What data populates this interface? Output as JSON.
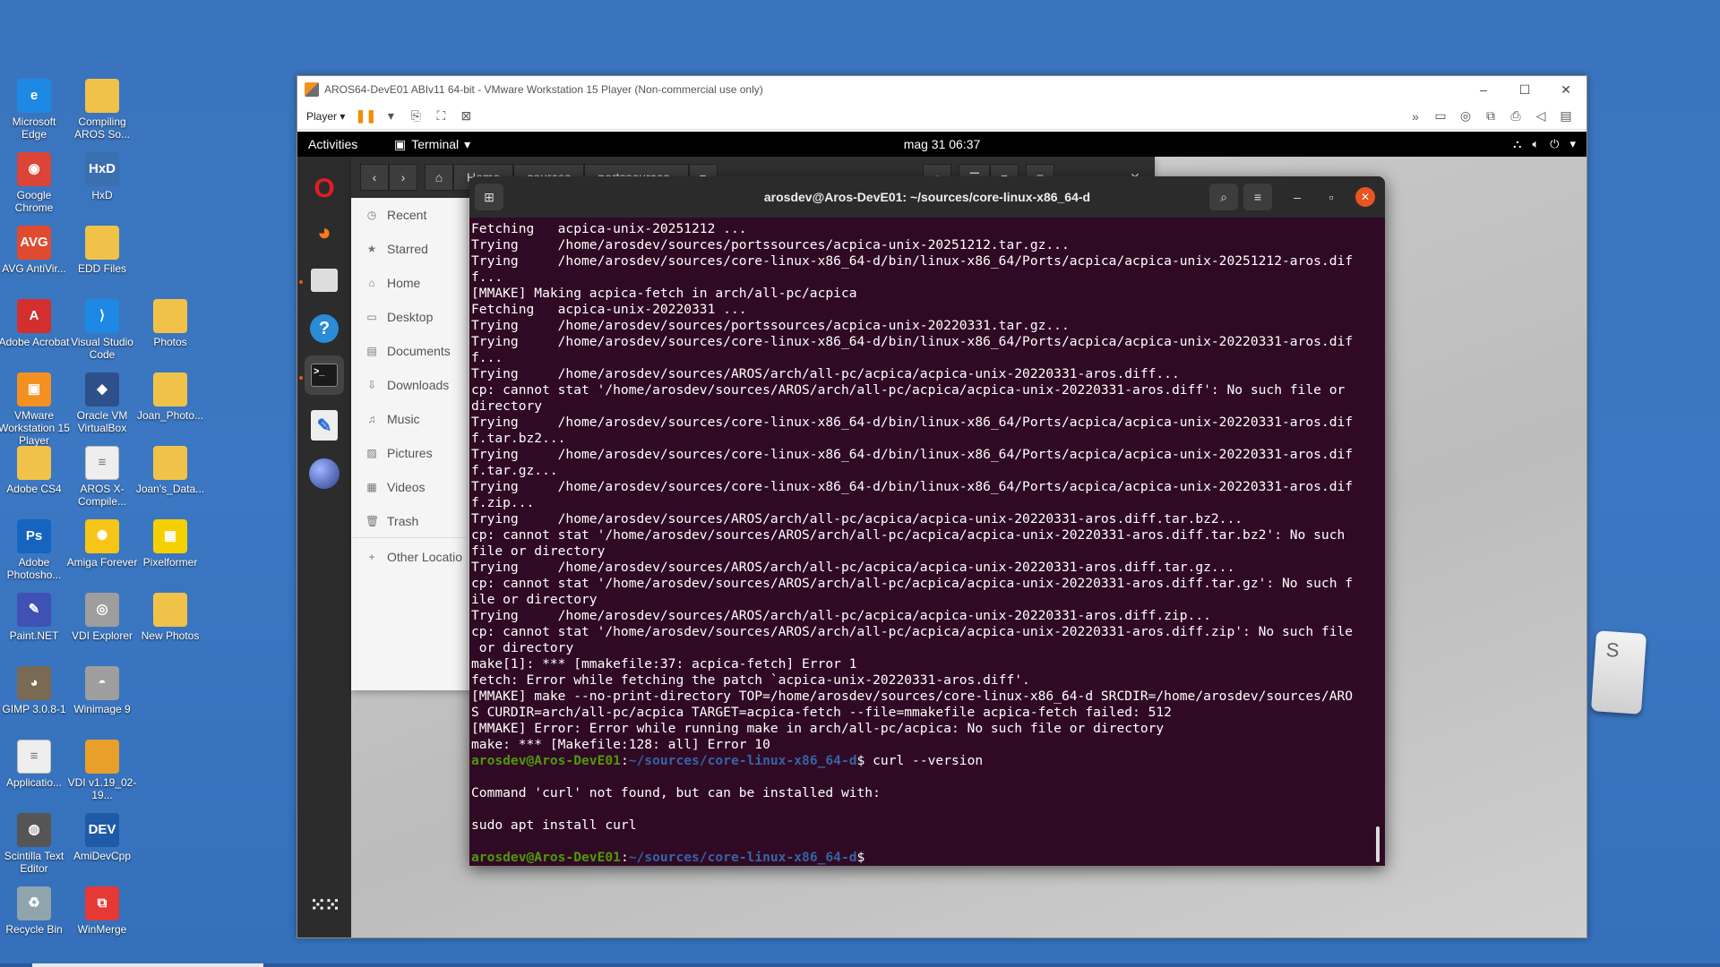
{
  "desktop": {
    "icons": [
      {
        "label": "Microsoft Edge",
        "glyph": "e",
        "color": "#1e88e5"
      },
      {
        "label": "Compiling AROS So...",
        "glyph": "",
        "color": "#f0c24a"
      },
      {
        "label": "Google Chrome",
        "glyph": "◉",
        "color": "#db4437"
      },
      {
        "label": "HxD",
        "glyph": "HxD",
        "color": "#3a6fb0"
      },
      {
        "label": "AVG AntiVir...",
        "glyph": "AVG",
        "color": "#e04a2f"
      },
      {
        "label": "EDD Files",
        "glyph": "",
        "color": "#f0c24a"
      },
      {
        "label": "Adobe Acrobat",
        "glyph": "A",
        "color": "#d32f2f"
      },
      {
        "label": "Visual Studio Code",
        "glyph": "⟩",
        "color": "#1e88e5"
      },
      {
        "label": "Photos",
        "glyph": "",
        "color": "#f0c24a"
      },
      {
        "label": "VMware Workstation 15 Player",
        "glyph": "▣",
        "color": "#f29121"
      },
      {
        "label": "Oracle VM VirtualBox",
        "glyph": "◆",
        "color": "#2d4f8a"
      },
      {
        "label": "Joan_Photo...",
        "glyph": "",
        "color": "#f0c24a"
      },
      {
        "label": "Adobe CS4",
        "glyph": "",
        "color": "#f0c24a"
      },
      {
        "label": "AROS X-Compile...",
        "glyph": "≡",
        "color": "#eeeeee"
      },
      {
        "label": "Joan's_Data...",
        "glyph": "",
        "color": "#f0c24a"
      },
      {
        "label": "Adobe Photosho...",
        "glyph": "Ps",
        "color": "#1565c0"
      },
      {
        "label": "Amiga Forever",
        "glyph": "✺",
        "color": "#f5c518"
      },
      {
        "label": "Pixelformer",
        "glyph": "▦",
        "color": "#f5d000"
      },
      {
        "label": "Paint.NET",
        "glyph": "✎",
        "color": "#3f51b5"
      },
      {
        "label": "VDI Explorer",
        "glyph": "◎",
        "color": "#9e9e9e"
      },
      {
        "label": "New Photos",
        "glyph": "",
        "color": "#f0c24a"
      },
      {
        "label": "GIMP 3.0.8-1",
        "glyph": "◕",
        "color": "#7a6a53"
      },
      {
        "label": "Winimage 9",
        "glyph": "◓",
        "color": "#9e9e9e"
      },
      {
        "label": "Applicatio...",
        "glyph": "≡",
        "color": "#eeeeee"
      },
      {
        "label": "VDI v1.19_02-19...",
        "glyph": "",
        "color": "#e8a02a"
      },
      {
        "label": "Scintilla Text Editor",
        "glyph": "◍",
        "color": "#555555"
      },
      {
        "label": "AmiDevCpp",
        "glyph": "DEV",
        "color": "#1e5aa8"
      },
      {
        "label": "Recycle Bin",
        "glyph": "♻",
        "color": "#90a4ae"
      },
      {
        "label": "WinMerge",
        "glyph": "⧉",
        "color": "#e53935"
      }
    ]
  },
  "vmware": {
    "title": "AROS64-DevE01 ABIv11 64-bit - VMware Workstation 15 Player (Non-commercial use only)",
    "player_label": "Player ▾",
    "minimize": "–",
    "maximize": "☐",
    "close": "✕"
  },
  "ubuntu": {
    "activities": "Activities",
    "app_menu": "Terminal",
    "clock": "mag 31  06:37"
  },
  "files": {
    "breadcrumbs": [
      "Home",
      "sources",
      "portssources"
    ],
    "sidebar": [
      {
        "label": "Recent",
        "icon": "◷"
      },
      {
        "label": "Starred",
        "icon": "★"
      },
      {
        "label": "Home",
        "icon": "⌂"
      },
      {
        "label": "Desktop",
        "icon": "▭"
      },
      {
        "label": "Documents",
        "icon": "▤"
      },
      {
        "label": "Downloads",
        "icon": "⇩"
      },
      {
        "label": "Music",
        "icon": "♫"
      },
      {
        "label": "Pictures",
        "icon": "▨"
      },
      {
        "label": "Videos",
        "icon": "▦"
      },
      {
        "label": "Trash",
        "icon": "🗑"
      },
      {
        "label": "Other Locatio",
        "icon": "+"
      }
    ]
  },
  "terminal": {
    "title": "arosdev@Aros-DevE01: ~/sources/core-linux-x86_64-d",
    "prompt_user": "arosdev@Aros-DevE01",
    "prompt_path": "~/sources/core-linux-x86_64-d",
    "lines": [
      "Fetching   acpica-unix-20251212 ...",
      "Trying     /home/arosdev/sources/portssources/acpica-unix-20251212.tar.gz...",
      "Trying     /home/arosdev/sources/core-linux-x86_64-d/bin/linux-x86_64/Ports/acpica/acpica-unix-20251212-aros.dif",
      "f...",
      "[MMAKE] Making acpica-fetch in arch/all-pc/acpica",
      "Fetching   acpica-unix-20220331 ...",
      "Trying     /home/arosdev/sources/portssources/acpica-unix-20220331.tar.gz...",
      "Trying     /home/arosdev/sources/core-linux-x86_64-d/bin/linux-x86_64/Ports/acpica/acpica-unix-20220331-aros.dif",
      "f...",
      "Trying     /home/arosdev/sources/AROS/arch/all-pc/acpica/acpica-unix-20220331-aros.diff...",
      "cp: cannot stat '/home/arosdev/sources/AROS/arch/all-pc/acpica/acpica-unix-20220331-aros.diff': No such file or",
      "directory",
      "Trying     /home/arosdev/sources/core-linux-x86_64-d/bin/linux-x86_64/Ports/acpica/acpica-unix-20220331-aros.dif",
      "f.tar.bz2...",
      "Trying     /home/arosdev/sources/core-linux-x86_64-d/bin/linux-x86_64/Ports/acpica/acpica-unix-20220331-aros.dif",
      "f.tar.gz...",
      "Trying     /home/arosdev/sources/core-linux-x86_64-d/bin/linux-x86_64/Ports/acpica/acpica-unix-20220331-aros.dif",
      "f.zip...",
      "Trying     /home/arosdev/sources/AROS/arch/all-pc/acpica/acpica-unix-20220331-aros.diff.tar.bz2...",
      "cp: cannot stat '/home/arosdev/sources/AROS/arch/all-pc/acpica/acpica-unix-20220331-aros.diff.tar.bz2': No such",
      "file or directory",
      "Trying     /home/arosdev/sources/AROS/arch/all-pc/acpica/acpica-unix-20220331-aros.diff.tar.gz...",
      "cp: cannot stat '/home/arosdev/sources/AROS/arch/all-pc/acpica/acpica-unix-20220331-aros.diff.tar.gz': No such f",
      "ile or directory",
      "Trying     /home/arosdev/sources/AROS/arch/all-pc/acpica/acpica-unix-20220331-aros.diff.zip...",
      "cp: cannot stat '/home/arosdev/sources/AROS/arch/all-pc/acpica/acpica-unix-20220331-aros.diff.zip': No such file",
      " or directory",
      "make[1]: *** [mmakefile:37: acpica-fetch] Error 1",
      "fetch: Error while fetching the patch `acpica-unix-20220331-aros.diff'.",
      "[MMAKE] make --no-print-directory TOP=/home/arosdev/sources/core-linux-x86_64-d SRCDIR=/home/arosdev/sources/ARO",
      "S CURDIR=arch/all-pc/acpica TARGET=acpica-fetch --file=mmakefile acpica-fetch failed: 512",
      "[MMAKE] Error: Error while running make in arch/all-pc/acpica: No such file or directory",
      "make: *** [Makefile:128: all] Error 10"
    ],
    "command1": " curl --version",
    "after_lines": [
      "",
      "Command 'curl' not found, but can be installed with:",
      "",
      "sudo apt install curl",
      ""
    ],
    "command2": " "
  },
  "keycap": {
    "letter": "S"
  }
}
